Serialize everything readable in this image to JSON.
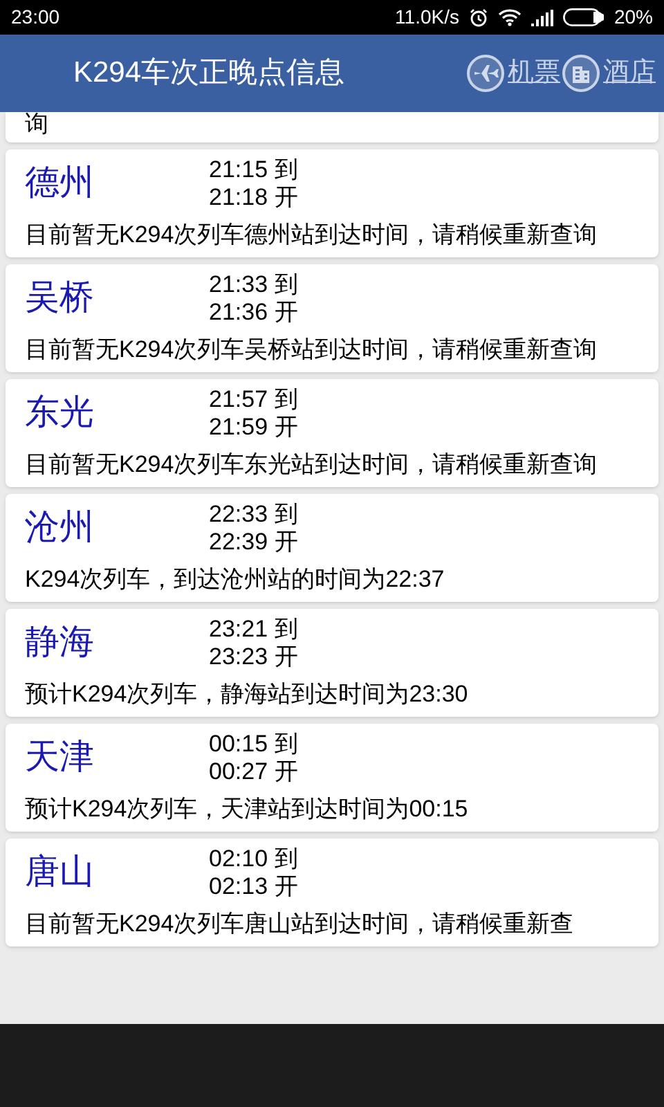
{
  "status_bar": {
    "time": "23:00",
    "speed": "11.0K/s",
    "battery": "20%"
  },
  "header": {
    "title": "K294车次正晚点信息",
    "links": [
      {
        "kind": "flight",
        "label": "机票"
      },
      {
        "kind": "hotel",
        "label": "酒店"
      }
    ]
  },
  "previous_card_message": "询",
  "stations": [
    {
      "name": "德州",
      "arrive": "21:15 到",
      "depart": "21:18 开",
      "message": "目前暂无K294次列车德州站到达时间，请稍候重新查询"
    },
    {
      "name": "吴桥",
      "arrive": "21:33 到",
      "depart": "21:36 开",
      "message": "目前暂无K294次列车吴桥站到达时间，请稍候重新查询"
    },
    {
      "name": "东光",
      "arrive": "21:57 到",
      "depart": "21:59 开",
      "message": "目前暂无K294次列车东光站到达时间，请稍候重新查询"
    },
    {
      "name": "沧州",
      "arrive": "22:33 到",
      "depart": "22:39 开",
      "message": "K294次列车，到达沧州站的时间为22:37"
    },
    {
      "name": "静海",
      "arrive": "23:21 到",
      "depart": "23:23 开",
      "message": "预计K294次列车，静海站到达时间为23:30"
    },
    {
      "name": "天津",
      "arrive": "00:15 到",
      "depart": "00:27 开",
      "message": "预计K294次列车，天津站到达时间为00:15"
    },
    {
      "name": "唐山",
      "arrive": "02:10 到",
      "depart": "02:13 开",
      "message": "目前暂无K294次列车唐山站到达时间，请稍候重新查"
    }
  ]
}
